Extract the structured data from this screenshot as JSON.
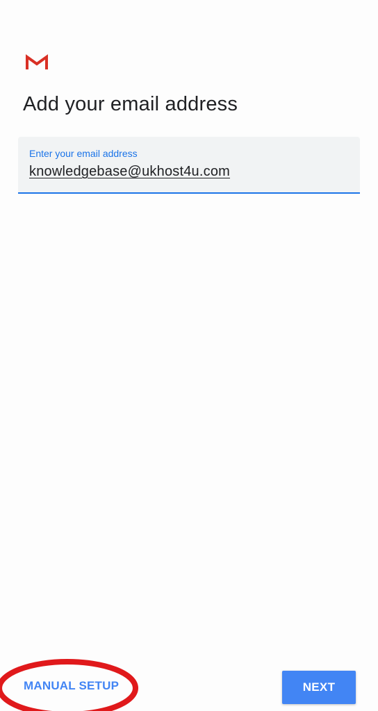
{
  "header": {
    "logo_icon": "gmail-logo-icon",
    "title": "Add your email address"
  },
  "email_field": {
    "label": "Enter your email address",
    "value": "knowledgebase@ukhost4u.com"
  },
  "footer": {
    "manual_setup_label": "MANUAL SETUP",
    "next_label": "NEXT"
  },
  "colors": {
    "accent": "#1a73e8",
    "button": "#4285f4",
    "annotation": "#e0191b",
    "gmail_red": "#d93025"
  }
}
